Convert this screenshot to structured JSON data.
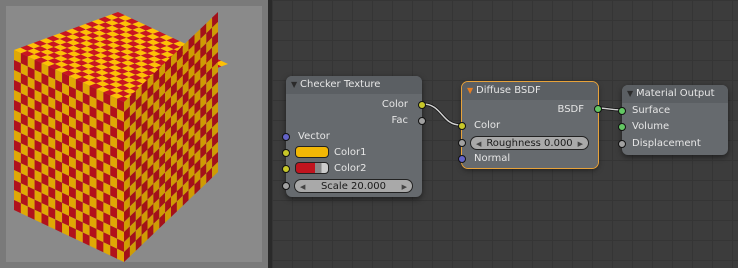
{
  "checker_colors": {
    "color1": "#f2b705",
    "color2": "#c0141e"
  },
  "nodes": {
    "checker": {
      "title": "Checker Texture",
      "out_color": "Color",
      "out_fac": "Fac",
      "in_vector": "Vector",
      "in_color1": "Color1",
      "in_color2": "Color2",
      "scale_label": "Scale 20.000"
    },
    "diffuse": {
      "title": "Diffuse BSDF",
      "out_bsdf": "BSDF",
      "in_color": "Color",
      "roughness_label": "Roughness 0.000",
      "in_normal": "Normal"
    },
    "output": {
      "title": "Material Output",
      "in_surface": "Surface",
      "in_volume": "Volume",
      "in_displacement": "Displacement"
    }
  }
}
